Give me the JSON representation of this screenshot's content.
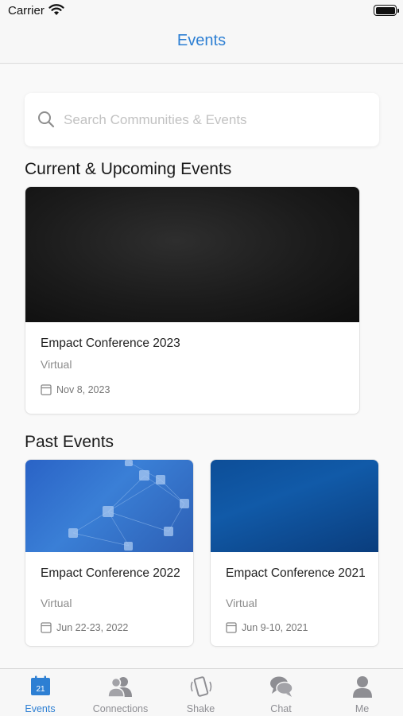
{
  "status_bar": {
    "carrier": "Carrier"
  },
  "nav": {
    "title": "Events"
  },
  "search": {
    "placeholder": "Search Communities & Events"
  },
  "sections": {
    "current": "Current & Upcoming Events",
    "past": "Past Events"
  },
  "current_events": [
    {
      "title": "Empact Conference 2023",
      "location": "Virtual",
      "date": "Nov 8, 2023"
    }
  ],
  "past_events": [
    {
      "title": "Empact Conference 2022",
      "location": "Virtual",
      "date": "Jun 22-23, 2022"
    },
    {
      "title": "Empact Conference 2021",
      "location": "Virtual",
      "date": "Jun 9-10, 2021"
    }
  ],
  "tabs": [
    {
      "label": "Events",
      "icon": "calendar-icon",
      "badge": "21",
      "active": true
    },
    {
      "label": "Connections",
      "icon": "people-icon",
      "active": false
    },
    {
      "label": "Shake",
      "icon": "phone-shake-icon",
      "active": false
    },
    {
      "label": "Chat",
      "icon": "chat-bubbles-icon",
      "active": false
    },
    {
      "label": "Me",
      "icon": "person-icon",
      "active": false
    }
  ],
  "colors": {
    "accent": "#2d7fd3",
    "inactive": "#8e8e93",
    "background": "#f9f9f9"
  }
}
